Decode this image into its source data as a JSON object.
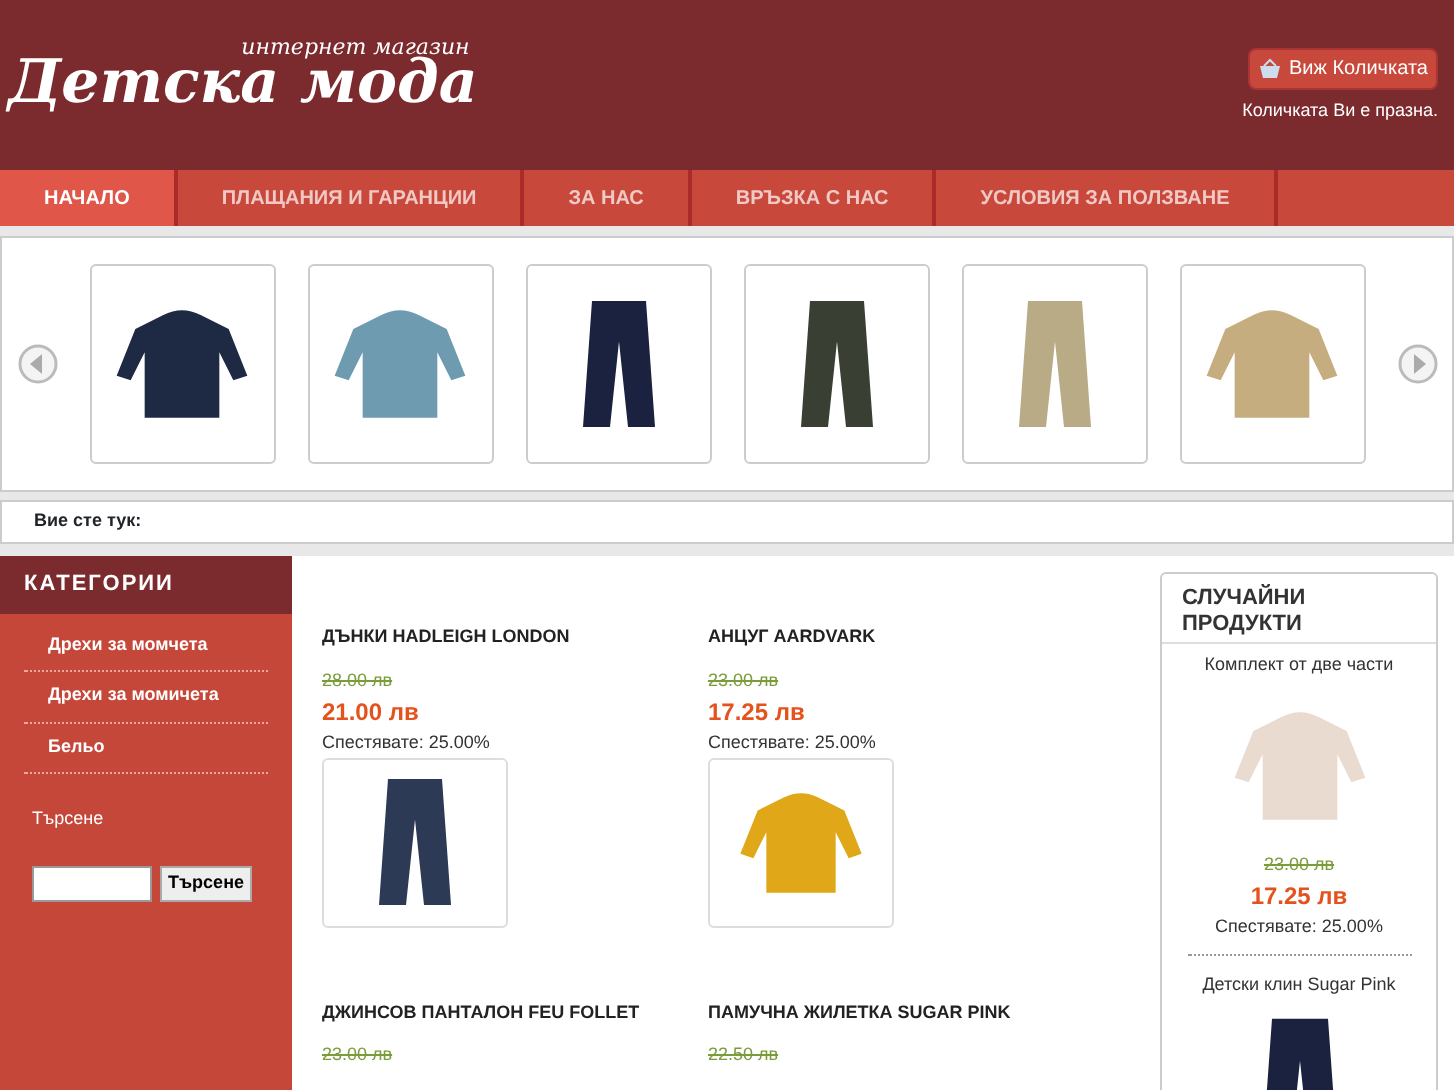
{
  "header": {
    "logo_subtitle": "интернет магазин",
    "logo": "Детска мода",
    "cart_button": "Виж Количката",
    "cart_status": "Количката Ви е празна."
  },
  "nav": [
    {
      "label": "НАЧАЛО",
      "selected": true
    },
    {
      "label": "ПЛАЩАНИЯ И ГАРАНЦИИ",
      "selected": false
    },
    {
      "label": "ЗА НАС",
      "selected": false
    },
    {
      "label": "ВРЪЗКА С НАС",
      "selected": false
    },
    {
      "label": "УСЛОВИЯ ЗА ПОЛЗВАНЕ",
      "selected": false
    }
  ],
  "carousel": [
    {
      "kind": "jacket",
      "color": "#1e2a44"
    },
    {
      "kind": "jacket",
      "color": "#6f9bb0"
    },
    {
      "kind": "pants",
      "color": "#1b2240"
    },
    {
      "kind": "pants",
      "color": "#3a3f33"
    },
    {
      "kind": "pants",
      "color": "#b9ab86"
    },
    {
      "kind": "jacket",
      "color": "#c6ad7f"
    }
  ],
  "breadcrumb": "Вие сте тук:",
  "sidebar": {
    "title": "КАТЕГОРИИ",
    "items": [
      "Дрехи за момчета",
      "Дрехи за момичета",
      "Бельо"
    ],
    "search_label": "Търсене",
    "search_button": "Търсене"
  },
  "products": [
    {
      "name": "ДЪНКИ HADLEIGH LONDON",
      "old_price": "28.00 лв",
      "price": "21.00 лв",
      "savings": "Спестявате: 25.00%",
      "kind": "pants",
      "color": "#2c3a55"
    },
    {
      "name": "АНЦУГ AARDVARK",
      "old_price": "23.00 лв",
      "price": "17.25 лв",
      "savings": "Спестявате: 25.00%",
      "kind": "jacket",
      "color": "#e0a818"
    },
    {
      "name": "ДЖИНСОВ ПАНТАЛОН FEU FOLLET",
      "old_price": "23.00 лв"
    },
    {
      "name": "ПАМУЧНА ЖИЛЕТКА SUGAR PINK",
      "old_price": "22.50 лв"
    }
  ],
  "random": {
    "title": "СЛУЧАЙНИ ПРОДУКТИ",
    "items": [
      {
        "name": "Комплект от две части",
        "old_price": "23.00 лв",
        "price": "17.25 лв",
        "savings": "Спестявате: 25.00%",
        "kind": "jacket",
        "color": "#eadbd0"
      },
      {
        "name": "Детски клин Sugar Pink",
        "kind": "pants",
        "color": "#1b2240"
      }
    ]
  }
}
